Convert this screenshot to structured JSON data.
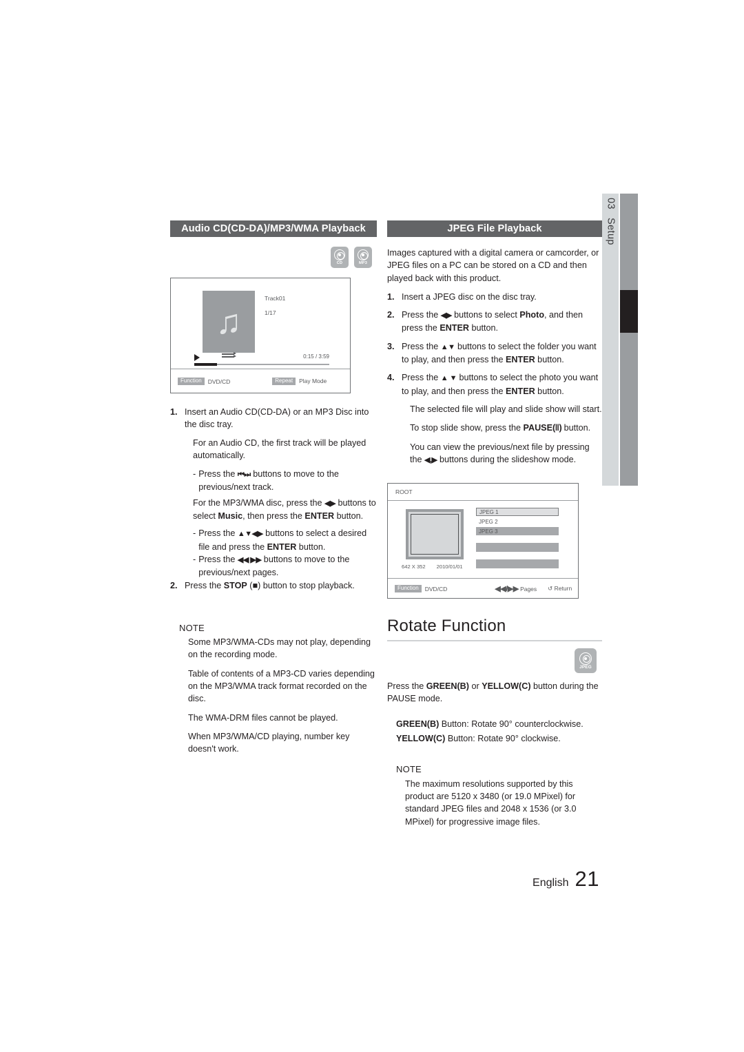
{
  "chapter_tab": {
    "number": "03",
    "label": "Setup"
  },
  "left_column": {
    "header": "Audio CD(CD-DA)/MP3/WMA Playback",
    "badges": [
      {
        "icon": "disc-icon",
        "label": "CD"
      },
      {
        "icon": "disc-icon",
        "label": "MP3"
      }
    ],
    "osd": {
      "track_title": "Track01",
      "track_index": "1/17",
      "time_elapsed": "0:15",
      "time_separator": "/",
      "time_total": "3:59",
      "foot_chip_left": "Function",
      "foot_label_left": "DVD/CD",
      "foot_chip_right": "Repeat",
      "foot_label_right": "Play Mode"
    },
    "steps": [
      {
        "num": "1.",
        "text": "Insert an Audio CD(CD-DA) or an MP3 Disc into the disc tray."
      },
      {
        "num": "2.",
        "text_pre": "Press the ",
        "bold": "STOP",
        "text_post": " (■) button to stop playback."
      }
    ],
    "sub_lines": {
      "auto_play": "For an Audio CD, the first track will be played automatically.",
      "dash1_pre": "Press the ",
      "dash1_icons": "⏮⏭",
      "dash1_post": " buttons to move to the previous/next track.",
      "mp3_pre": "For the MP3/WMA disc, press the ",
      "mp3_icons": "◀▶",
      "mp3_mid": " buttons to select ",
      "mp3_bold1": "Music",
      "mp3_mid2": ", then press the ",
      "mp3_bold2": "ENTER",
      "mp3_post": " button.",
      "dash2_pre": "Press the ",
      "dash2_icons": "▲▼◀▶",
      "dash2_mid": " buttons to select  a desired file and press the ",
      "dash2_bold": "ENTER",
      "dash2_post": " button.",
      "dash3_pre": "Press the ",
      "dash3_icons": "◀◀ ▶▶",
      "dash3_post": " buttons to move to the previous/next pages."
    },
    "note": {
      "heading": "NOTE",
      "items": [
        "Some MP3/WMA-CDs may not play, depending on the recording mode.",
        "Table of contents of a MP3-CD varies depending on the MP3/WMA track format recorded on the disc.",
        "The WMA-DRM files cannot be played.",
        "When MP3/WMA/CD playing, number key doesn't work."
      ]
    }
  },
  "right_column": {
    "header": "JPEG File Playback",
    "intro": "Images captured with a digital camera or camcorder, or JPEG files on a PC can be stored on a CD and then played back with this product.",
    "steps": [
      {
        "num": "1.",
        "text": "Insert a JPEG disc on the disc tray."
      },
      {
        "num": "2.",
        "pre": "Press the ",
        "icons": "◀▶",
        "mid": " buttons to select ",
        "bold1": "Photo",
        "mid2": ", and then press the ",
        "bold2": "ENTER",
        "post": " button."
      },
      {
        "num": "3.",
        "pre": "Press the ",
        "icons": "▲▼",
        "mid": " buttons to select the folder you want to play, and then press the ",
        "bold2": "ENTER",
        "post": " button."
      },
      {
        "num": "4.",
        "pre": "Press the ",
        "icons": "▲ ▼",
        "mid": " buttons to select the photo you want to play, and then press the ",
        "bold2": "ENTER",
        "post": " button."
      }
    ],
    "step4_subs": {
      "line1": "The selected file will play and slide show will start.",
      "line2_pre": "To stop slide show, press the ",
      "line2_bold": "PAUSE",
      "line2_icon": "(‖)",
      "line2_post": " button.",
      "line3_pre": "You can view the previous/next file by pressing the ",
      "line3_icons": "◀,▶",
      "line3_post": " buttons during the slideshow mode."
    },
    "osd": {
      "title": "ROOT",
      "files": [
        {
          "label": "JPEG 1",
          "state": "selected"
        },
        {
          "label": "JPEG 2",
          "state": "plain"
        },
        {
          "label": "JPEG 3",
          "state": "filled"
        }
      ],
      "resolution": "642 X 352",
      "date": "2010/01/01",
      "foot_chip": "Function",
      "foot_label": "DVD/CD",
      "foot_pages_icon": "◀◀/▶▶",
      "foot_pages": "Pages",
      "foot_return_icon": "↺",
      "foot_return": "Return"
    },
    "rotate": {
      "title": "Rotate Function",
      "badge": {
        "icon": "disc-icon",
        "label": "JPEG"
      },
      "intro_pre": "Press the ",
      "intro_bold1": "GREEN(B)",
      "intro_mid": " or ",
      "intro_bold2": "YELLOW(C)",
      "intro_post": " button during the PAUSE mode.",
      "line_green_bold": "GREEN(B)",
      "line_green_rest": " Button: Rotate 90° counterclockwise.",
      "line_yellow_bold": "YELLOW(C)",
      "line_yellow_rest": " Button: Rotate 90° clockwise.",
      "note": {
        "heading": "NOTE",
        "text": "The maximum resolutions supported by this product are 5120 x 3480 (or 19.0 MPixel) for standard JPEG files and 2048 x 1536 (or 3.0 MPixel) for progressive image files."
      }
    }
  },
  "footer": {
    "language": "English",
    "page_number": "21"
  }
}
